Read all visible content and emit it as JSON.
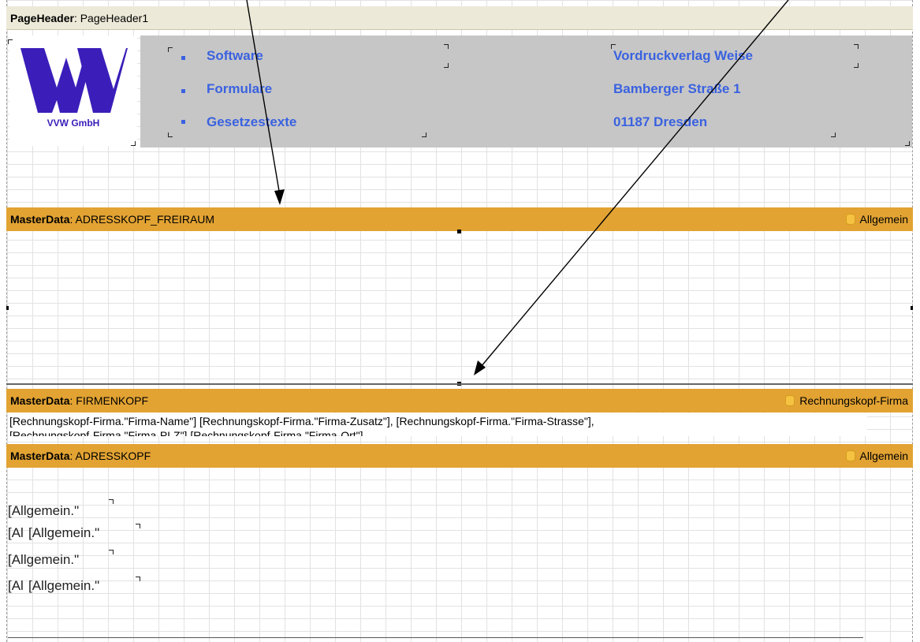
{
  "page_header": {
    "title_bold": "PageHeader",
    "title_rest": ": PageHeader1"
  },
  "logo": {
    "caption": "VVW GmbH"
  },
  "header_list": [
    "Software",
    "Formulare",
    "Gesetzestexte"
  ],
  "address": [
    "Vordruckverlag Weise",
    "Bamberger Straße 1",
    "01187 Dresden"
  ],
  "bands": [
    {
      "bold": "MasterData",
      "name": ": ADRESSKOPF_FREIRAUM",
      "source": "Allgemein"
    },
    {
      "bold": "MasterData",
      "name": ": FIRMENKOPF",
      "source": "Rechnungskopf-Firma"
    },
    {
      "bold": "MasterData",
      "name": ": ADRESSKOPF",
      "source": "Allgemein"
    }
  ],
  "firmenkopf_line1": "[Rechnungskopf-Firma.\"Firma-Name\"] [Rechnungskopf-Firma.\"Firma-Zusatz\"], [Rechnungskopf-Firma.\"Firma-Strasse\"],",
  "firmenkopf_line2": "[Rechnungskopf-Firma.\"Firma-PLZ\"] [Rechnungskopf-Firma.\"Firma-Ort\"]",
  "adress_fields": {
    "a1": "[Allgemein.\"",
    "b1": "[Al",
    "b2": "[Allgemein.\"",
    "a2": "[Allgemein.\"",
    "c1": "[Al",
    "c2": "[Allgemein.\""
  },
  "colors": {
    "masterdata_band": "#e2a333",
    "page_header_band": "#ece9d8",
    "header_gray": "#c6c6c6",
    "header_text": "#3a62e0",
    "logo": "#3b1eb9"
  }
}
